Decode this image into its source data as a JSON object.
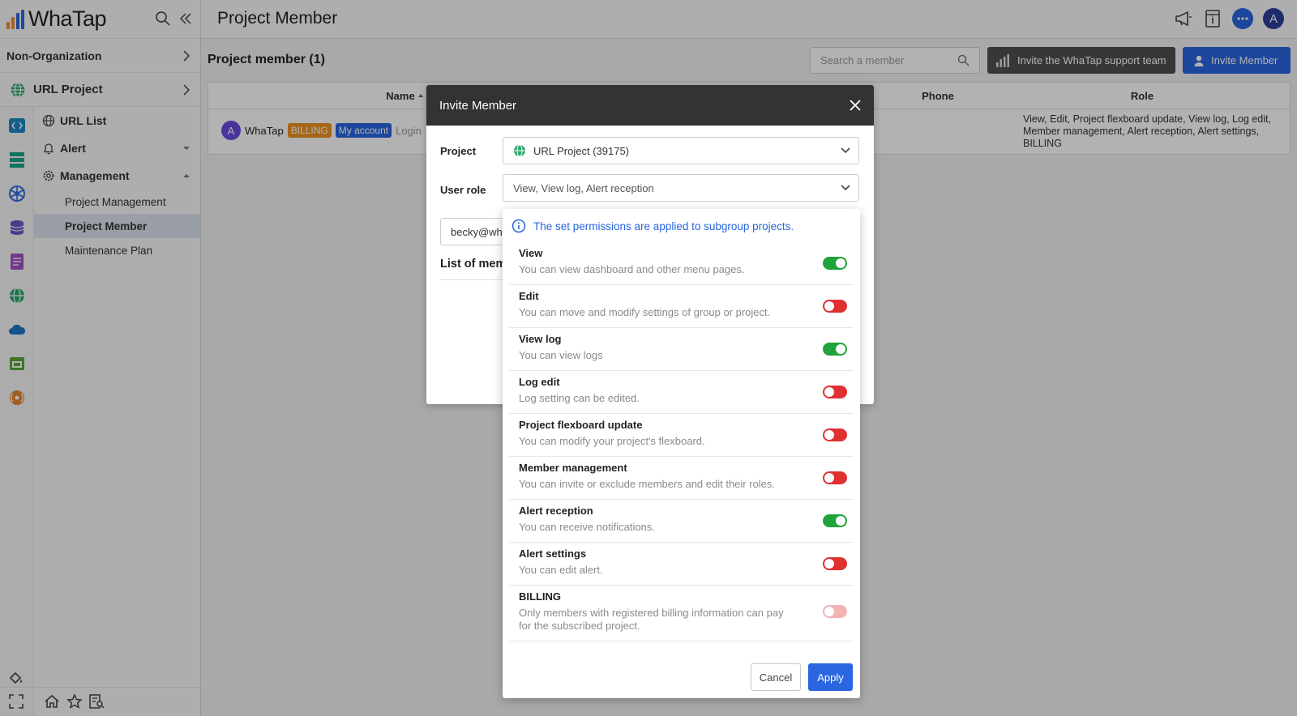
{
  "app": {
    "logo_text": "WhaTap",
    "brand_color": "#2966e0"
  },
  "sidebar": {
    "organization": "Non-Organization",
    "project": "URL Project",
    "nav": {
      "url_list": "URL List",
      "alert": "Alert",
      "management": "Management",
      "sub_items": [
        "Project Management",
        "Project Member",
        "Maintenance Plan"
      ],
      "active_sub": "Project Member"
    }
  },
  "header": {
    "title": "Project Member"
  },
  "main": {
    "title": "Project member (1)",
    "search_placeholder": "Search a member",
    "support_button": "Invite the WhaTap support team",
    "invite_button": "Invite Member",
    "table": {
      "columns": {
        "name": "Name",
        "phone": "Phone",
        "role": "Role"
      },
      "row": {
        "avatar_letter": "A",
        "name": "WhaTap",
        "badge_billing": "BILLING",
        "badge_account": "My account",
        "login_partial": "Login",
        "role": "View, Edit, Project flexboard update, View log, Log edit, Member management, Alert reception, Alert settings, BILLING"
      }
    }
  },
  "modal": {
    "title": "Invite Member",
    "project_label": "Project",
    "project_value": "URL Project (39175)",
    "role_label": "User role",
    "role_value": "View, View log, Alert reception",
    "email_value": "becky@wha",
    "list_title": "List of mem"
  },
  "dropdown": {
    "info": "The set permissions are applied to subgroup projects.",
    "permissions": [
      {
        "title": "View",
        "desc": "You can view dashboard and other menu pages.",
        "state": "on"
      },
      {
        "title": "Edit",
        "desc": "You can move and modify settings of group or project.",
        "state": "off"
      },
      {
        "title": "View log",
        "desc": "You can view logs",
        "state": "on"
      },
      {
        "title": "Log edit",
        "desc": "Log setting can be edited.",
        "state": "off"
      },
      {
        "title": "Project flexboard update",
        "desc": "You can modify your project's flexboard.",
        "state": "off"
      },
      {
        "title": "Member management",
        "desc": "You can invite or exclude members and edit their roles.",
        "state": "off"
      },
      {
        "title": "Alert reception",
        "desc": "You can receive notifications.",
        "state": "on"
      },
      {
        "title": "Alert settings",
        "desc": "You can edit alert.",
        "state": "off"
      },
      {
        "title": "BILLING",
        "desc": "Only members with registered billing information can pay for the subscribed project.",
        "state": "disabled"
      }
    ],
    "cancel": "Cancel",
    "apply": "Apply"
  }
}
